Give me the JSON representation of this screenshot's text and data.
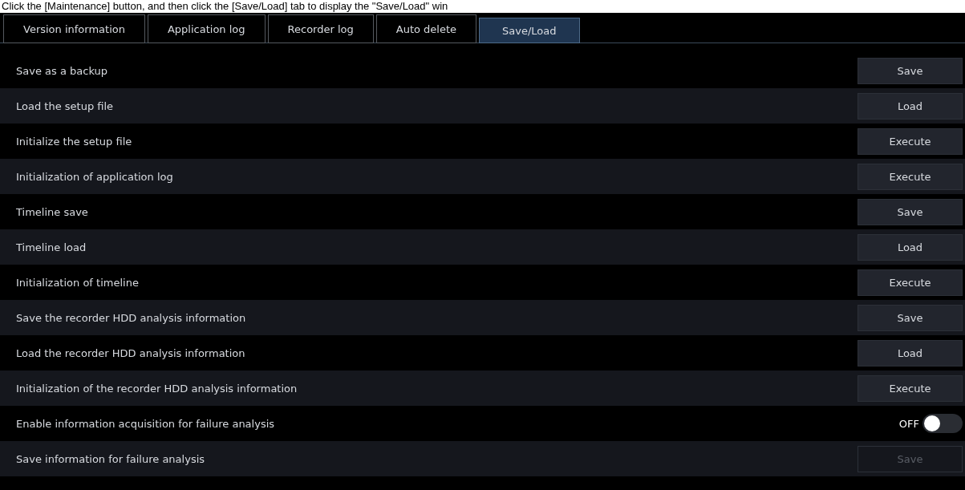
{
  "caption": "Click the [Maintenance] button, and then click the [Save/Load] tab to display the \"Save/Load\" win",
  "tabs": [
    {
      "label": "Version information",
      "selected": false
    },
    {
      "label": "Application log",
      "selected": false
    },
    {
      "label": "Recorder log",
      "selected": false
    },
    {
      "label": "Auto delete",
      "selected": false
    },
    {
      "label": "Save/Load",
      "selected": true
    }
  ],
  "rows": [
    {
      "label": "Save as a backup",
      "kind": "button",
      "button": "Save",
      "disabled": false
    },
    {
      "label": "Load the setup file",
      "kind": "button",
      "button": "Load",
      "disabled": false
    },
    {
      "label": "Initialize the setup file",
      "kind": "button",
      "button": "Execute",
      "disabled": false
    },
    {
      "label": "Initialization of application log",
      "kind": "button",
      "button": "Execute",
      "disabled": false
    },
    {
      "label": "Timeline save",
      "kind": "button",
      "button": "Save",
      "disabled": false
    },
    {
      "label": "Timeline load",
      "kind": "button",
      "button": "Load",
      "disabled": false
    },
    {
      "label": "Initialization of timeline",
      "kind": "button",
      "button": "Execute",
      "disabled": false
    },
    {
      "label": "Save the recorder HDD analysis information",
      "kind": "button",
      "button": "Save",
      "disabled": false
    },
    {
      "label": "Load the recorder HDD analysis information",
      "kind": "button",
      "button": "Load",
      "disabled": false
    },
    {
      "label": "Initialization of the recorder HDD analysis information",
      "kind": "button",
      "button": "Execute",
      "disabled": false
    },
    {
      "label": "Enable information acquisition for failure analysis",
      "kind": "toggle",
      "state": "OFF",
      "on": false
    },
    {
      "label": "Save information for failure analysis",
      "kind": "button",
      "button": "Save",
      "disabled": true
    }
  ]
}
